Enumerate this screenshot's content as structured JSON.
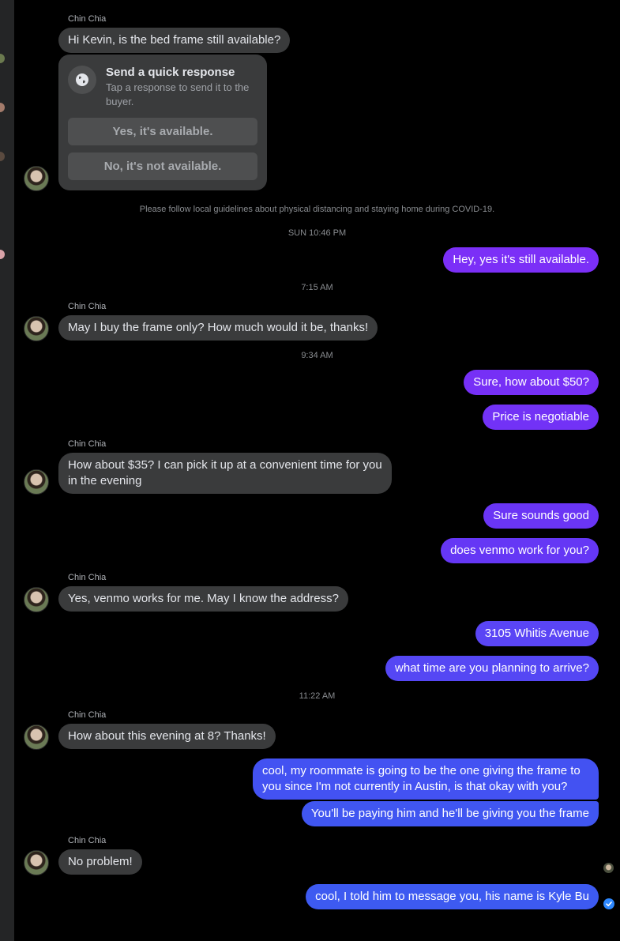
{
  "contact": {
    "name": "Chin Chia"
  },
  "quick_response": {
    "title": "Send a quick response",
    "subtitle": "Tap a response to send it to the buyer.",
    "option_yes": "Yes, it's available.",
    "option_no": "No, it's not available."
  },
  "notices": {
    "covid": "Please follow local guidelines about physical distancing and staying home during COVID-19."
  },
  "timestamps": {
    "t1": "SUN 10:46 PM",
    "t2": "7:15 AM",
    "t3": "9:34 AM",
    "t4": "11:22 AM"
  },
  "messages": {
    "m1": "Hi Kevin, is the bed frame still available?",
    "m2": "Hey, yes it's still available.",
    "m3": "May I buy the frame only? How much would it be, thanks!",
    "m4": "Sure, how about $50?",
    "m5": "Price is negotiable",
    "m6": "How about $35? I can pick it up at a convenient time for you in the evening",
    "m7": "Sure sounds good",
    "m8": "does venmo work for you?",
    "m9": "Yes, venmo works for me. May I know the address?",
    "m10": "3105 Whitis Avenue",
    "m11": "what time are you planning to arrive?",
    "m12": "How about this evening at 8? Thanks!",
    "m13": "cool, my roommate is going to be the one giving the frame to you since I'm not currently in Austin, is that okay with you?",
    "m14": "You'll be paying him and he'll be giving you the frame",
    "m15": "No problem!",
    "m16": "cool, I told him to message you, his name is Kyle Bu"
  },
  "colors": {
    "background": "#000000",
    "incoming_bubble": "#3a3b3c",
    "outgoing_purple": "#7b2ff7",
    "outgoing_indigo": "#5a45f5",
    "outgoing_blue": "#3d5af1",
    "read_receipt": "#2d88ff"
  }
}
